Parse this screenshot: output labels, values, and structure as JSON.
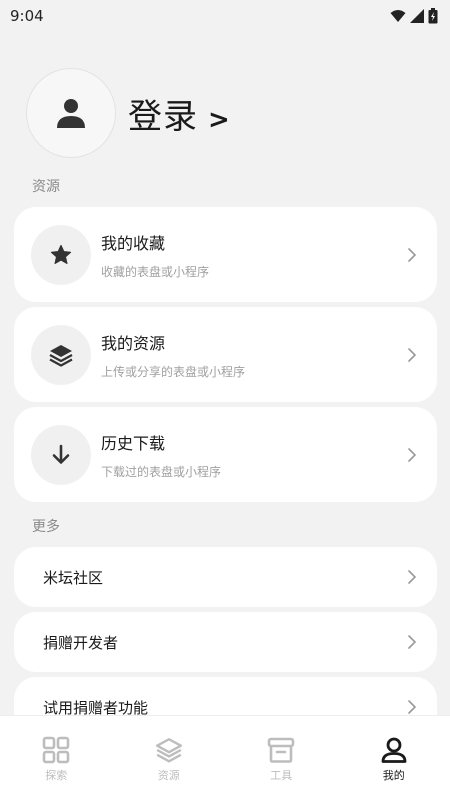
{
  "status_bar": {
    "time": "9:04"
  },
  "profile": {
    "login_label": "登录",
    "arrow": ">"
  },
  "sections": {
    "resources_label": "资源",
    "more_label": "更多"
  },
  "resource_cards": [
    {
      "icon": "star-icon",
      "title": "我的收藏",
      "subtitle": "收藏的表盘或小程序"
    },
    {
      "icon": "layers-icon",
      "title": "我的资源",
      "subtitle": "上传或分享的表盘或小程序"
    },
    {
      "icon": "download-arrow-icon",
      "title": "历史下载",
      "subtitle": "下载过的表盘或小程序"
    }
  ],
  "more_rows": [
    {
      "label": "米坛社区"
    },
    {
      "label": "捐赠开发者"
    },
    {
      "label": "试用捐赠者功能"
    }
  ],
  "bottom_nav": {
    "items": [
      {
        "icon": "grid-icon",
        "label": "探索",
        "active": false
      },
      {
        "icon": "layers-icon",
        "label": "资源",
        "active": false
      },
      {
        "icon": "archive-icon",
        "label": "工具",
        "active": false
      },
      {
        "icon": "person-icon",
        "label": "我的",
        "active": true
      }
    ]
  },
  "colors": {
    "background": "#f2f2f2",
    "card": "#ffffff",
    "text_primary": "#1a1a1a",
    "text_secondary": "#a0a0a0",
    "nav_inactive": "#bdbdbd"
  }
}
